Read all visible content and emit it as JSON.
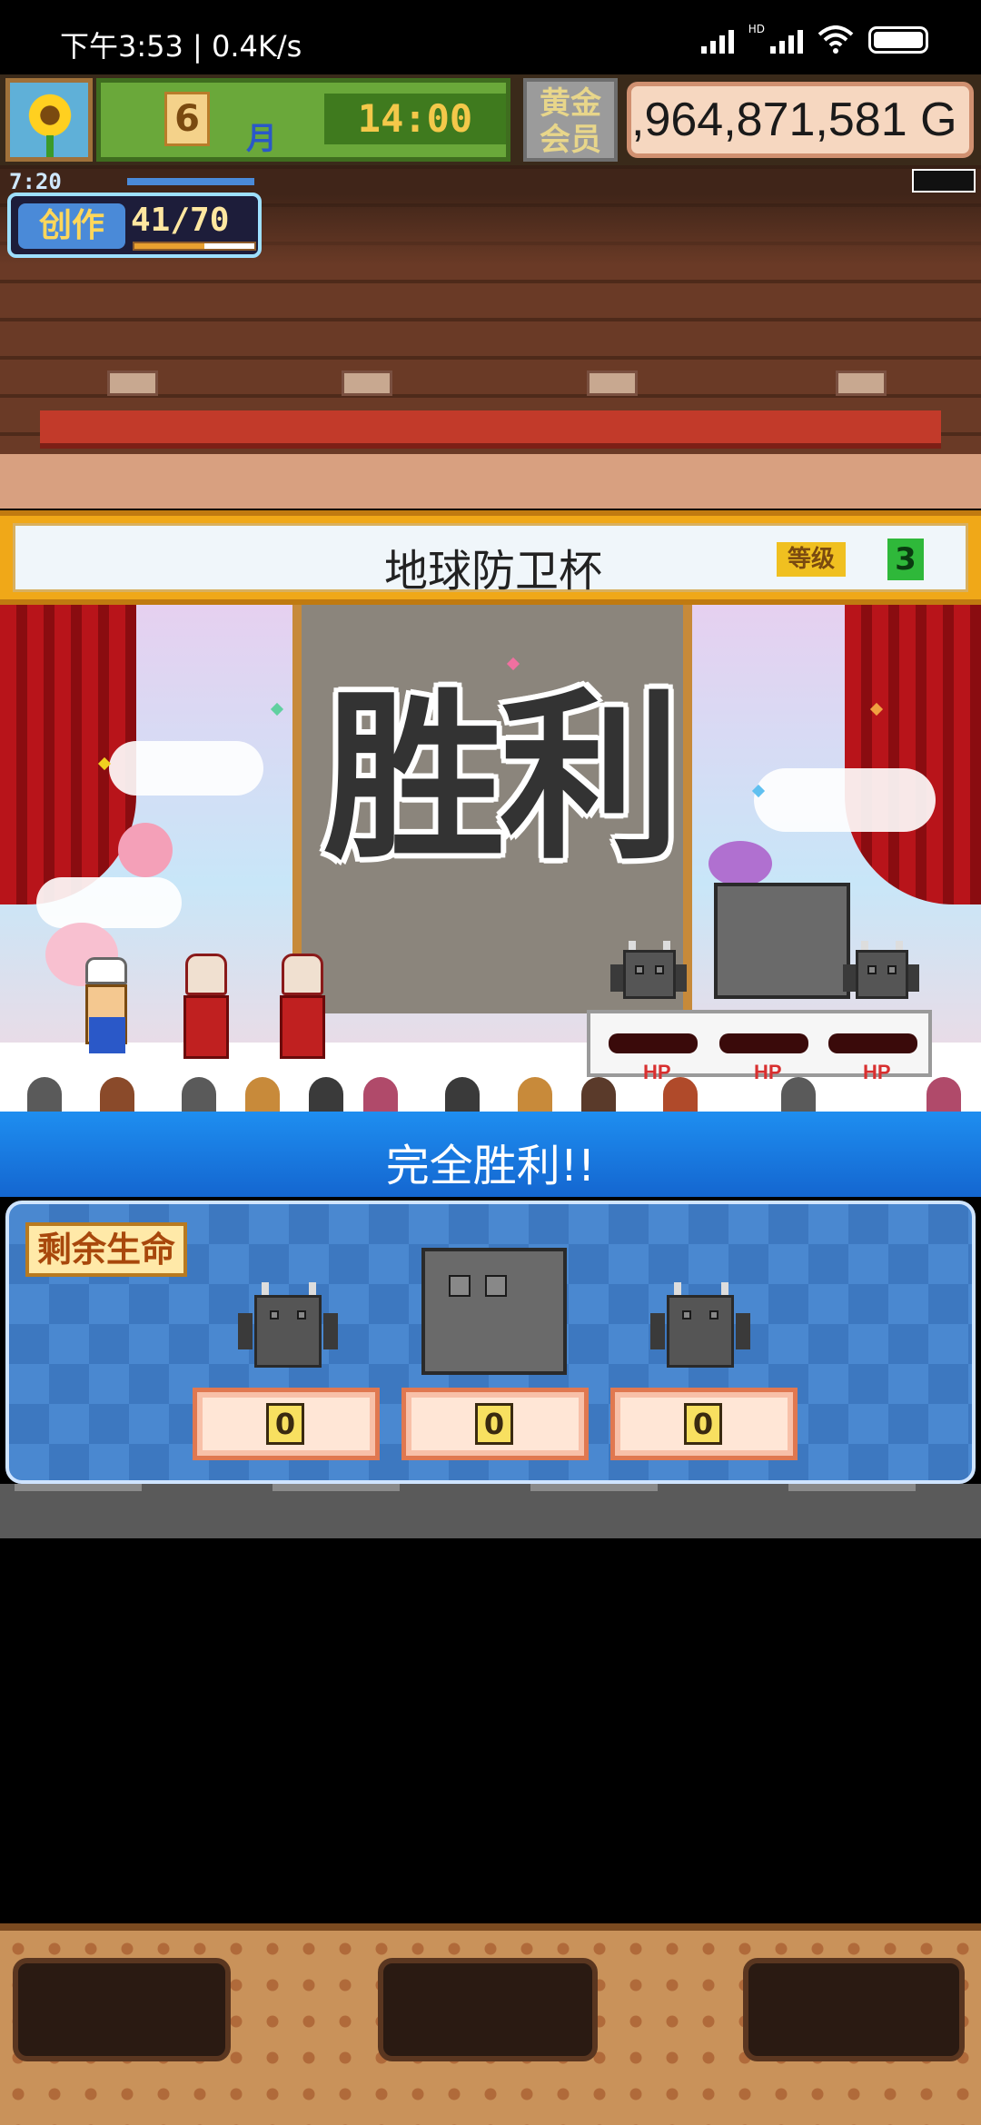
{
  "status_bar": {
    "time_speed": "下午3:53 | 0.4K/s",
    "hd_label": "HD",
    "icons": [
      "signal-icon",
      "hd-signal-icon",
      "wifi-icon",
      "battery-icon"
    ]
  },
  "hud": {
    "month_number": "6",
    "month_unit": "月",
    "clock": "14:00",
    "member_badge": "黄金\n会员",
    "gold": ",964,871,581 G"
  },
  "create": {
    "timer": "7:20",
    "label": "创作",
    "count": "41/70",
    "progress": 0.586
  },
  "tournament": {
    "name": "地球防卫杯",
    "rank_label": "等级",
    "rank_value": "3"
  },
  "arena": {
    "victory_text": "胜利",
    "hp_labels": [
      "HP",
      "HP",
      "HP"
    ]
  },
  "result": {
    "header": "完全胜利!!",
    "lives_label": "剩余生命",
    "enemies": [
      {
        "name_icon": "imp-icon",
        "lives": "0"
      },
      {
        "name_icon": "boss-icon",
        "lives": "0"
      },
      {
        "name_icon": "imp-icon",
        "lives": "0"
      }
    ]
  },
  "bottom_menu": {
    "slots": [
      "",
      "",
      ""
    ]
  }
}
